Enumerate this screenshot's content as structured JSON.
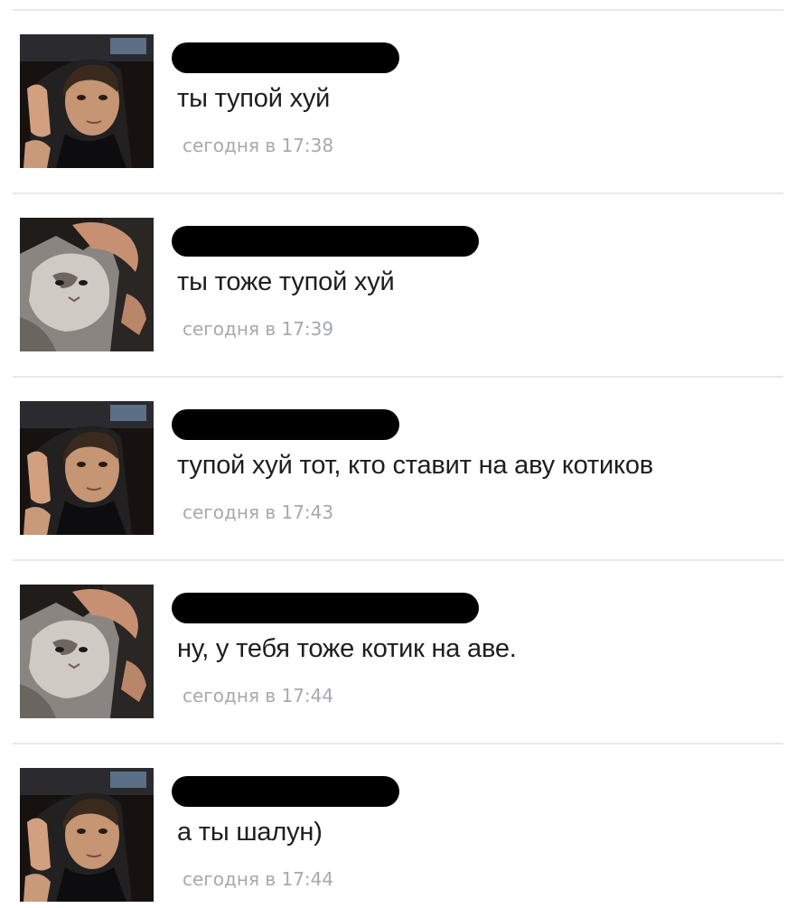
{
  "messages": [
    {
      "avatar": "man-photo-avatar",
      "name_redacted": true,
      "text": "ты тупой хуй",
      "time": "сегодня в 17:38"
    },
    {
      "avatar": "cat-photo-avatar",
      "name_redacted": true,
      "text": "ты тоже тупой хуй",
      "time": "сегодня в 17:39"
    },
    {
      "avatar": "man-photo-avatar",
      "name_redacted": true,
      "text": "тупой хуй тот, кто ставит на аву котиков",
      "time": "сегодня в 17:43"
    },
    {
      "avatar": "cat-photo-avatar",
      "name_redacted": true,
      "text": "ну, у тебя тоже котик на аве.",
      "time": "сегодня в 17:44"
    },
    {
      "avatar": "man-photo-avatar",
      "name_redacted": true,
      "text": "а ты шалун)",
      "time": "сегодня в 17:44"
    }
  ],
  "colors": {
    "background": "#ffffff",
    "divider": "#e7e9ee",
    "message_text": "#1e1e1e",
    "timestamp": "#a6a9af",
    "redaction": "#000000"
  }
}
